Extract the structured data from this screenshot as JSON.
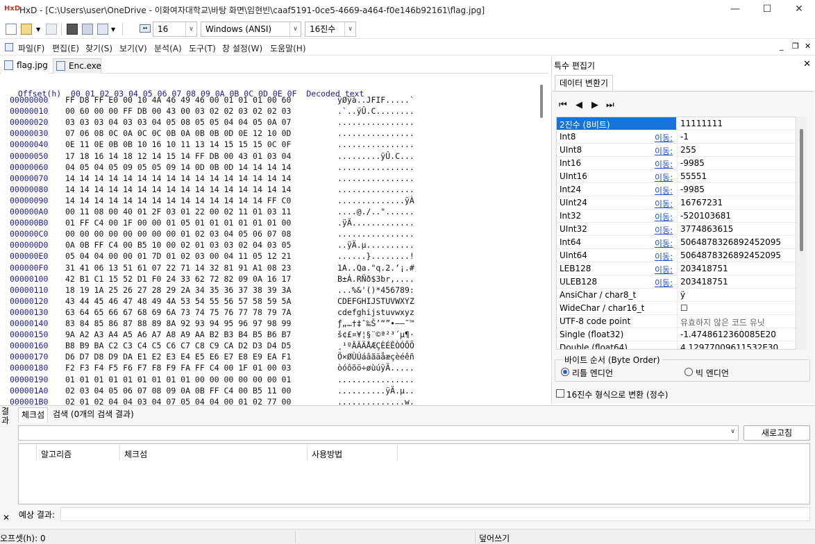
{
  "window": {
    "logo": "HxD",
    "title": "HxD - [C:\\Users\\user\\OneDrive - 이화여자대학교\\바탕 화면\\임현빈\\caaf5191-0ce5-4669-a464-f0e146b92161\\flag.jpg]",
    "minimize": "—",
    "maximize": "☐",
    "close": "✕"
  },
  "toolbar": {
    "bytes_per_row": "16",
    "charset": "Windows (ANSI)",
    "number_base": "16진수",
    "dropdown_arrow": "∨"
  },
  "menu": [
    "파일(F)",
    "편집(E)",
    "찾기(S)",
    "보기(V)",
    "분석(A)",
    "도구(T)",
    "창 설정(W)",
    "도움말(H)"
  ],
  "menu_right": {
    "min": "_",
    "restore": "❐",
    "close": "✕"
  },
  "tabs": [
    {
      "label": "flag.jpg"
    },
    {
      "label": "Enc.exe"
    }
  ],
  "hex": {
    "header_offset": "Offset(h)",
    "header_columns": "00 01 02 03 04 05 06 07 08 09 0A 0B 0C 0D 0E 0F",
    "header_decoded": "Decoded text",
    "rows": [
      {
        "off": "00000000",
        "bytes": "FF D8 FF E0 00 10 4A 46 49 46 00 01 01 01 00 60",
        "text": "ÿØÿà..JFIF.....`"
      },
      {
        "off": "00000010",
        "bytes": "00 60 00 00 FF DB 00 43 00 03 02 02 03 02 02 03",
        "text": ".`..ÿÛ.C........"
      },
      {
        "off": "00000020",
        "bytes": "03 03 03 04 03 03 04 05 08 05 05 04 04 05 0A 07",
        "text": "................"
      },
      {
        "off": "00000030",
        "bytes": "07 06 08 0C 0A 0C 0C 0B 0A 0B 0B 0D 0E 12 10 0D",
        "text": "................"
      },
      {
        "off": "00000040",
        "bytes": "0E 11 0E 0B 0B 10 16 10 11 13 14 15 15 15 0C 0F",
        "text": "................"
      },
      {
        "off": "00000050",
        "bytes": "17 18 16 14 18 12 14 15 14 FF DB 00 43 01 03 04",
        "text": ".........ÿÛ.C..."
      },
      {
        "off": "00000060",
        "bytes": "04 05 04 05 09 05 05 09 14 0D 0B 0D 14 14 14 14",
        "text": "................"
      },
      {
        "off": "00000070",
        "bytes": "14 14 14 14 14 14 14 14 14 14 14 14 14 14 14 14",
        "text": "................"
      },
      {
        "off": "00000080",
        "bytes": "14 14 14 14 14 14 14 14 14 14 14 14 14 14 14 14",
        "text": "................"
      },
      {
        "off": "00000090",
        "bytes": "14 14 14 14 14 14 14 14 14 14 14 14 14 14 FF C0",
        "text": "..............ÿÀ"
      },
      {
        "off": "000000A0",
        "bytes": "00 11 08 00 40 01 2F 03 01 22 00 02 11 01 03 11",
        "text": "....@./..\"......"
      },
      {
        "off": "000000B0",
        "bytes": "01 FF C4 00 1F 00 00 01 05 01 01 01 01 01 01 00",
        "text": ".ÿÄ............."
      },
      {
        "off": "000000C0",
        "bytes": "00 00 00 00 00 00 00 00 01 02 03 04 05 06 07 08",
        "text": "................"
      },
      {
        "off": "000000D0",
        "bytes": "0A 0B FF C4 00 B5 10 00 02 01 03 03 02 04 03 05",
        "text": "..ÿÄ.µ.........."
      },
      {
        "off": "000000E0",
        "bytes": "05 04 04 00 00 01 7D 01 02 03 00 04 11 05 12 21",
        "text": "......}........!"
      },
      {
        "off": "000000F0",
        "bytes": "31 41 06 13 51 61 07 22 71 14 32 81 91 A1 08 23",
        "text": "1A..Qa.\"q.2.‘¡.#"
      },
      {
        "off": "00000100",
        "bytes": "42 B1 C1 15 52 D1 F0 24 33 62 72 82 09 0A 16 17",
        "text": "B±Á.RÑð$3br‚...."
      },
      {
        "off": "00000110",
        "bytes": "18 19 1A 25 26 27 28 29 2A 34 35 36 37 38 39 3A",
        "text": "...%&'()*456789:"
      },
      {
        "off": "00000120",
        "bytes": "43 44 45 46 47 48 49 4A 53 54 55 56 57 58 59 5A",
        "text": "CDEFGHIJSTUVWXYZ"
      },
      {
        "off": "00000130",
        "bytes": "63 64 65 66 67 68 69 6A 73 74 75 76 77 78 79 7A",
        "text": "cdefghijstuvwxyz"
      },
      {
        "off": "00000140",
        "bytes": "83 84 85 86 87 88 89 8A 92 93 94 95 96 97 98 99",
        "text": "ƒ„…†‡ˆ‰Š’“”•–—˜™"
      },
      {
        "off": "00000150",
        "bytes": "9A A2 A3 A4 A5 A6 A7 A8 A9 AA B2 B3 B4 B5 B6 B7",
        "text": "š¢£¤¥¦§¨©ª²³´µ¶·"
      },
      {
        "off": "00000160",
        "bytes": "B8 B9 BA C2 C3 C4 C5 C6 C7 C8 C9 CA D2 D3 D4 D5",
        "text": "¸¹ºÂÃÄÅÆÇÈÉÊÒÓÔÕ"
      },
      {
        "off": "00000170",
        "bytes": "D6 D7 D8 D9 DA E1 E2 E3 E4 E5 E6 E7 E8 E9 EA F1",
        "text": "Ö×ØÙÚáâãäåæçèéêñ"
      },
      {
        "off": "00000180",
        "bytes": "F2 F3 F4 F5 F6 F7 F8 F9 FA FF C4 00 1F 01 00 03",
        "text": "òóôõö÷øùúÿÄ....."
      },
      {
        "off": "00000190",
        "bytes": "01 01 01 01 01 01 01 01 01 00 00 00 00 00 00 01",
        "text": "................"
      },
      {
        "off": "000001A0",
        "bytes": "02 03 04 05 06 07 08 09 0A 0B FF C4 00 B5 11 00",
        "text": "..........ÿÄ.µ.."
      },
      {
        "off": "000001B0",
        "bytes": "02 01 02 04 04 03 04 07 05 04 04 00 01 02 77 00",
        "text": "..............w."
      }
    ]
  },
  "special_editor": {
    "title": "특수 편집기",
    "close": "✕",
    "tab": "데이터 변환기",
    "nav": [
      "⏮",
      "◀",
      "▶",
      "⏭"
    ],
    "goto_label": "이동:",
    "rows": [
      {
        "name": "2진수 (8비트)",
        "value": "11111111",
        "link": false,
        "selected": true
      },
      {
        "name": "Int8",
        "value": "-1",
        "link": true
      },
      {
        "name": "UInt8",
        "value": "255",
        "link": true
      },
      {
        "name": "Int16",
        "value": "-9985",
        "link": true
      },
      {
        "name": "UInt16",
        "value": "55551",
        "link": true
      },
      {
        "name": "Int24",
        "value": "-9985",
        "link": true
      },
      {
        "name": "UInt24",
        "value": "16767231",
        "link": true
      },
      {
        "name": "Int32",
        "value": "-520103681",
        "link": true
      },
      {
        "name": "UInt32",
        "value": "3774863615",
        "link": true
      },
      {
        "name": "Int64",
        "value": "5064878326892452095",
        "link": true
      },
      {
        "name": "UInt64",
        "value": "5064878326892452095",
        "link": true
      },
      {
        "name": "LEB128",
        "value": "203418751",
        "link": true
      },
      {
        "name": "ULEB128",
        "value": "203418751",
        "link": true
      },
      {
        "name": "AnsiChar / char8_t",
        "value": "ÿ",
        "link": false
      },
      {
        "name": "WideChar / char16_t",
        "value": "☐",
        "link": false
      },
      {
        "name": "UTF-8 code point",
        "value": "유효하지 않은 코드 유닛",
        "link": false,
        "dim": true
      },
      {
        "name": "Single (float32)",
        "value": "-1.4748612360085E20",
        "link": false
      },
      {
        "name": "Double (float64)",
        "value": "4.12977009611532E30",
        "link": false
      }
    ],
    "byte_order_label": "바이트 순서 (Byte Order)",
    "little_endian": "리틀 엔디언",
    "big_endian": "빅 엔디언",
    "hex_int_checkbox": "16진수 형식으로 변환 (정수)"
  },
  "results": {
    "side_label": "결과",
    "side_close": "✕",
    "tab_checksum": "체크섬",
    "tab_search": "검색 (0개의 검색 결과)",
    "refresh": "새로고침",
    "col_algorithm": "알고리즘",
    "col_checksum": "체크섬",
    "col_usage": "사용방법",
    "expected_label": "예상 결과:"
  },
  "status": {
    "offset": "오프셋(h): 0",
    "mode": "덮어쓰기"
  },
  "colors": {
    "offset_blue": "#1a1aa0",
    "selection_blue": "#1873d6",
    "link_blue": "#1a4fd0",
    "grey_byte": "#8a8a8a"
  }
}
